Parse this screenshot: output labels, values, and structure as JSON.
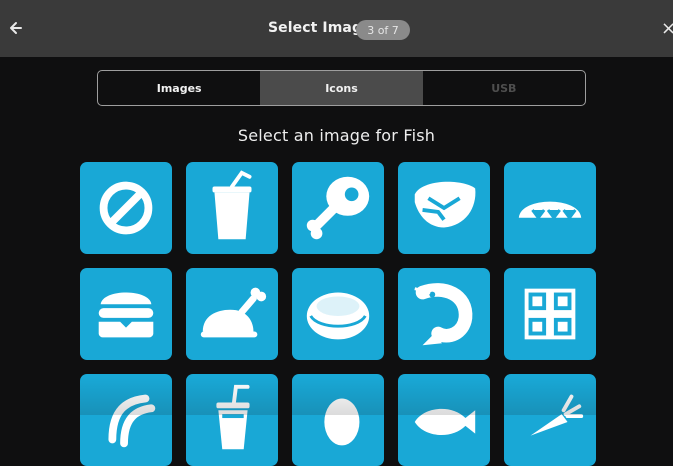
{
  "header": {
    "title": "Select Image",
    "progress": "3 of 7",
    "back_icon": "back-arrow-icon",
    "close_icon": "close-icon"
  },
  "tabs": [
    {
      "label": "Images",
      "state": "normal"
    },
    {
      "label": "Icons",
      "state": "active"
    },
    {
      "label": "USB",
      "state": "disabled"
    }
  ],
  "prompt": "Select an image for Fish",
  "tiles": [
    {
      "icon": "no-entry-icon"
    },
    {
      "icon": "drink-cup-icon"
    },
    {
      "icon": "ham-leg-icon"
    },
    {
      "icon": "steak-icon"
    },
    {
      "icon": "bread-loaf-icon"
    },
    {
      "icon": "burger-icon"
    },
    {
      "icon": "roast-chicken-icon"
    },
    {
      "icon": "meat-slice-icon"
    },
    {
      "icon": "shrimp-icon"
    },
    {
      "icon": "grid-icon"
    },
    {
      "icon": "bacon-icon"
    },
    {
      "icon": "shaker-drink-icon"
    },
    {
      "icon": "egg-icon"
    },
    {
      "icon": "fish-icon"
    },
    {
      "icon": "vegetable-icon"
    }
  ],
  "colors": {
    "tile_blue": "#19a8d6",
    "header_bg": "#3a3a3a",
    "screen_bg": "#0f0f10",
    "active_tab_bg": "#4b4b4b"
  }
}
